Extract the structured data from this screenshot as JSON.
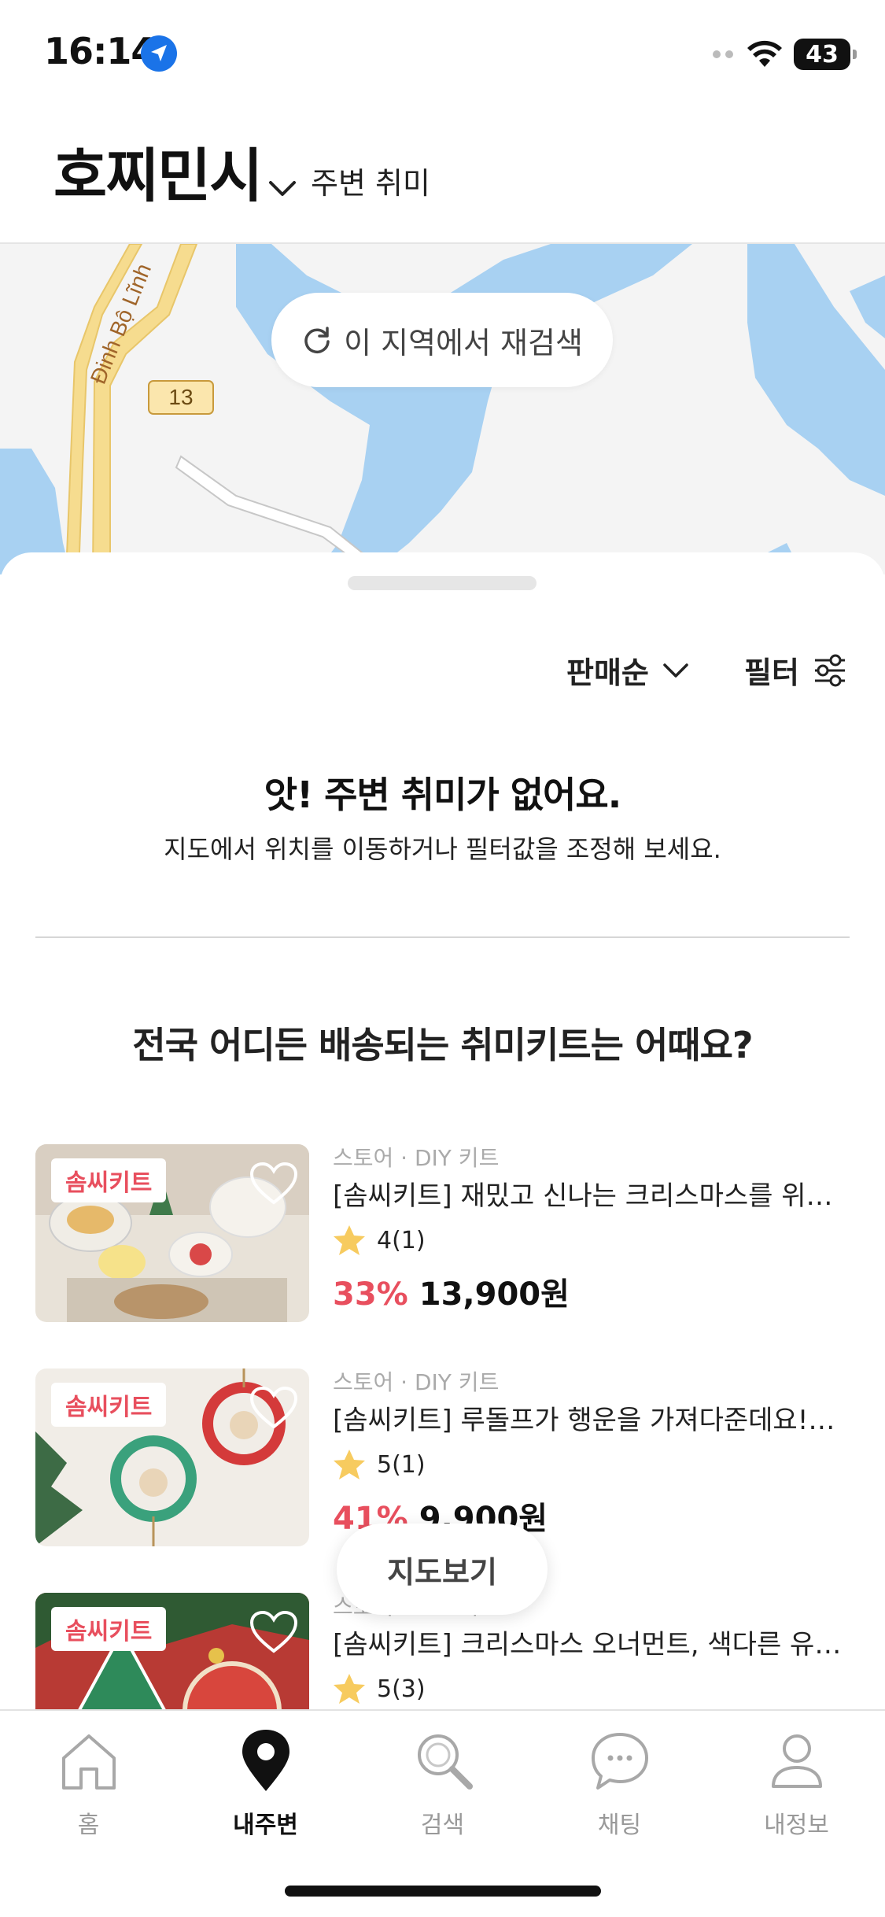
{
  "status_bar": {
    "time": "16:14",
    "battery": "43"
  },
  "header": {
    "city": "호찌민시",
    "subtitle": "주변 취미"
  },
  "map": {
    "research_label": "이 지역에서 재검색",
    "road_label": "Đinh Bộ Lĩnh",
    "route_shield": "13"
  },
  "sheet": {
    "sort_label": "판매순",
    "filter_label": "필터",
    "empty_title": "앗! 주변 취미가 없어요.",
    "empty_desc": "지도에서 위치를 이동하거나 필터값을 조정해 보세요.",
    "section_title": "전국 어디든 배송되는 취미키트는 어때요?"
  },
  "products": [
    {
      "badge": "솜씨키트",
      "category": "스토어 · DIY 키트",
      "title": "[솜씨키트] 재밌고 신나는 크리스마스를 위한…",
      "rating": "4(1)",
      "discount": "33%",
      "price": "13,900원"
    },
    {
      "badge": "솜씨키트",
      "category": "스토어 · DIY 키트",
      "title": "[솜씨키트] 루돌프가 행운을 가져다준데요!…",
      "rating": "5(1)",
      "discount": "41%",
      "price": "9,900원"
    },
    {
      "badge": "솜씨키트",
      "category": "스토어 · DIY 키트",
      "title": "[솜씨키트] 크리스마스 오너먼트, 색다른 유…",
      "rating": "5(3)",
      "discount": "",
      "price": ""
    }
  ],
  "map_view_button": "지도보기",
  "tabs": [
    {
      "label": "홈",
      "icon": "home-icon"
    },
    {
      "label": "내주변",
      "icon": "location-pin-icon"
    },
    {
      "label": "검색",
      "icon": "search-icon"
    },
    {
      "label": "채팅",
      "icon": "chat-icon"
    },
    {
      "label": "내정보",
      "icon": "user-icon"
    }
  ],
  "colors": {
    "accent": "#e84f5e",
    "map_water": "#a8d1f2",
    "map_road": "#f6dc8f"
  }
}
